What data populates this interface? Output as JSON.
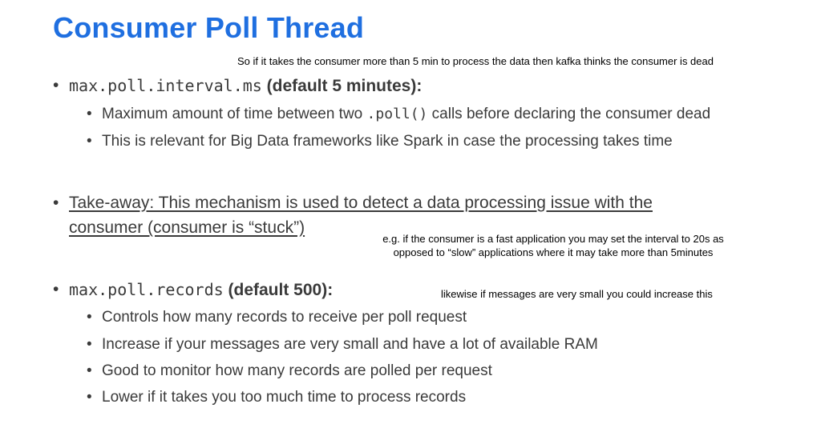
{
  "title": "Consumer Poll Thread",
  "notes": {
    "timeout_note": "So if it takes the consumer more than 5 min to process the data then kafka thinks the consumer is dead",
    "interval_note_line1": "e.g. if the consumer is a fast application you may set the interval to 20s as",
    "interval_note_line2": "opposed to “slow” applications where it may take more than 5minutes",
    "records_note": "likewise if messages are very small you could increase this"
  },
  "sections": {
    "interval": {
      "key": "max.poll.interval.ms",
      "default": "(default 5 minutes):",
      "sub1_before": "Maximum amount of time between two ",
      "sub1_code": ".poll()",
      "sub1_after": " calls before declaring the consumer dead",
      "sub2": "This is relevant for Big Data frameworks like Spark in case the processing takes time"
    },
    "takeaway": {
      "line1": "Take-away: This mechanism is used to detect a data processing issue with the",
      "line2": "consumer (consumer is “stuck”)"
    },
    "records": {
      "key": "max.poll.records",
      "default": "(default 500):",
      "items": [
        "Controls how many records to receive per poll request",
        "Increase if your messages are very small and have a lot of available RAM",
        "Good to monitor how many records are polled per request",
        "Lower if it takes you too much time to process records"
      ]
    }
  },
  "bullet_char": "•"
}
